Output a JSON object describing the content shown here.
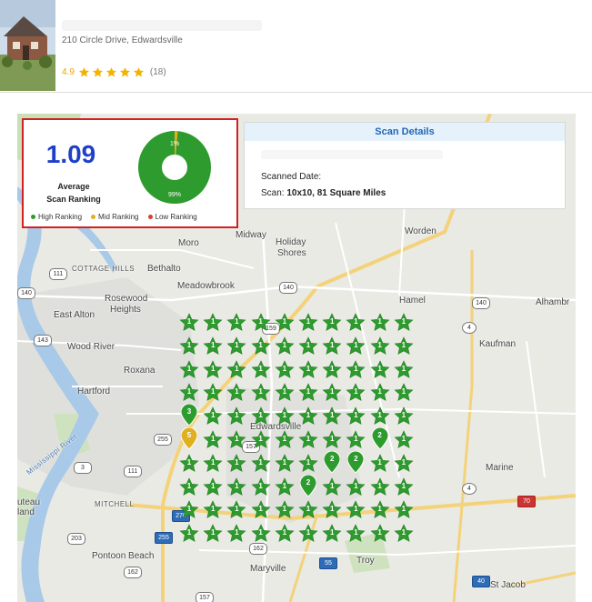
{
  "listing": {
    "address": "210 Circle Drive, Edwardsville",
    "rating": "4.9",
    "stars": 5,
    "review_count": "(18)"
  },
  "summary": {
    "avg_value": "1.09",
    "avg_label_line1": "Average",
    "avg_label_line2": "Scan Ranking",
    "donut_top_label": "1%",
    "donut_bottom_label": "99%",
    "legend": [
      {
        "label": "High Ranking",
        "color": "#2e9b2e"
      },
      {
        "label": "Mid Ranking",
        "color": "#e0b020"
      },
      {
        "label": "Low Ranking",
        "color": "#e03a2a"
      }
    ]
  },
  "details": {
    "title": "Scan Details",
    "scanned_date_label": "Scanned Date:",
    "scan_label": "Scan:",
    "scan_value": "10x10, 81 Square Miles"
  },
  "colors": {
    "high": "#2e9b2e",
    "mid": "#e0b020",
    "low": "#e03a2a",
    "accent": "#1f3fc8"
  },
  "map": {
    "places": [
      "Moro",
      "Midway",
      "Holiday",
      "Shores",
      "Worden",
      "Bethalto",
      "Meadowbrook",
      "Hamel",
      "Alhambr",
      "Rosewood",
      "Heights",
      "East Alton",
      "Wood River",
      "Kaufman",
      "Roxana",
      "Hartford",
      "Edwardsville",
      "Marine",
      "MITCHELL",
      "uteau",
      "land",
      "Pontoon Beach",
      "Maryville",
      "Troy",
      "St Jacob",
      "COTTAGE HILLS",
      "Mississippi River"
    ],
    "routes": [
      "111",
      "140",
      "143",
      "159",
      "140",
      "140",
      "4",
      "255",
      "3",
      "111",
      "157",
      "4",
      "70",
      "203",
      "162",
      "55",
      "162",
      "40",
      "157",
      "111",
      "270",
      "255"
    ]
  },
  "grid": {
    "rows": [
      [
        "1",
        "1",
        "1",
        "1",
        "1",
        "1",
        "1",
        "1",
        "1",
        "1"
      ],
      [
        "1",
        "1",
        "1",
        "1",
        "1",
        "1",
        "1",
        "1",
        "1",
        "1"
      ],
      [
        "1",
        "1",
        "1",
        "1",
        "1",
        "1",
        "1",
        "1",
        "1",
        "1"
      ],
      [
        "1",
        "1",
        "1",
        "1",
        "1",
        "1",
        "1",
        "1",
        "1",
        "1"
      ],
      [
        "3",
        "1",
        "1",
        "1",
        "1",
        "1",
        "1",
        "1",
        "1",
        "1"
      ],
      [
        "5",
        "1",
        "1",
        "1",
        "1",
        "1",
        "1",
        "1",
        "2",
        "1"
      ],
      [
        "1",
        "1",
        "1",
        "1",
        "1",
        "1",
        "2",
        "2",
        "1",
        "1"
      ],
      [
        "1",
        "1",
        "1",
        "1",
        "1",
        "2",
        "1",
        "1",
        "1",
        "1"
      ],
      [
        "1",
        "1",
        "1",
        "1",
        "1",
        "1",
        "1",
        "1",
        "1",
        "1"
      ],
      [
        "1",
        "1",
        "1",
        "1",
        "1",
        "1",
        "1",
        "1",
        "1",
        "1"
      ]
    ]
  }
}
